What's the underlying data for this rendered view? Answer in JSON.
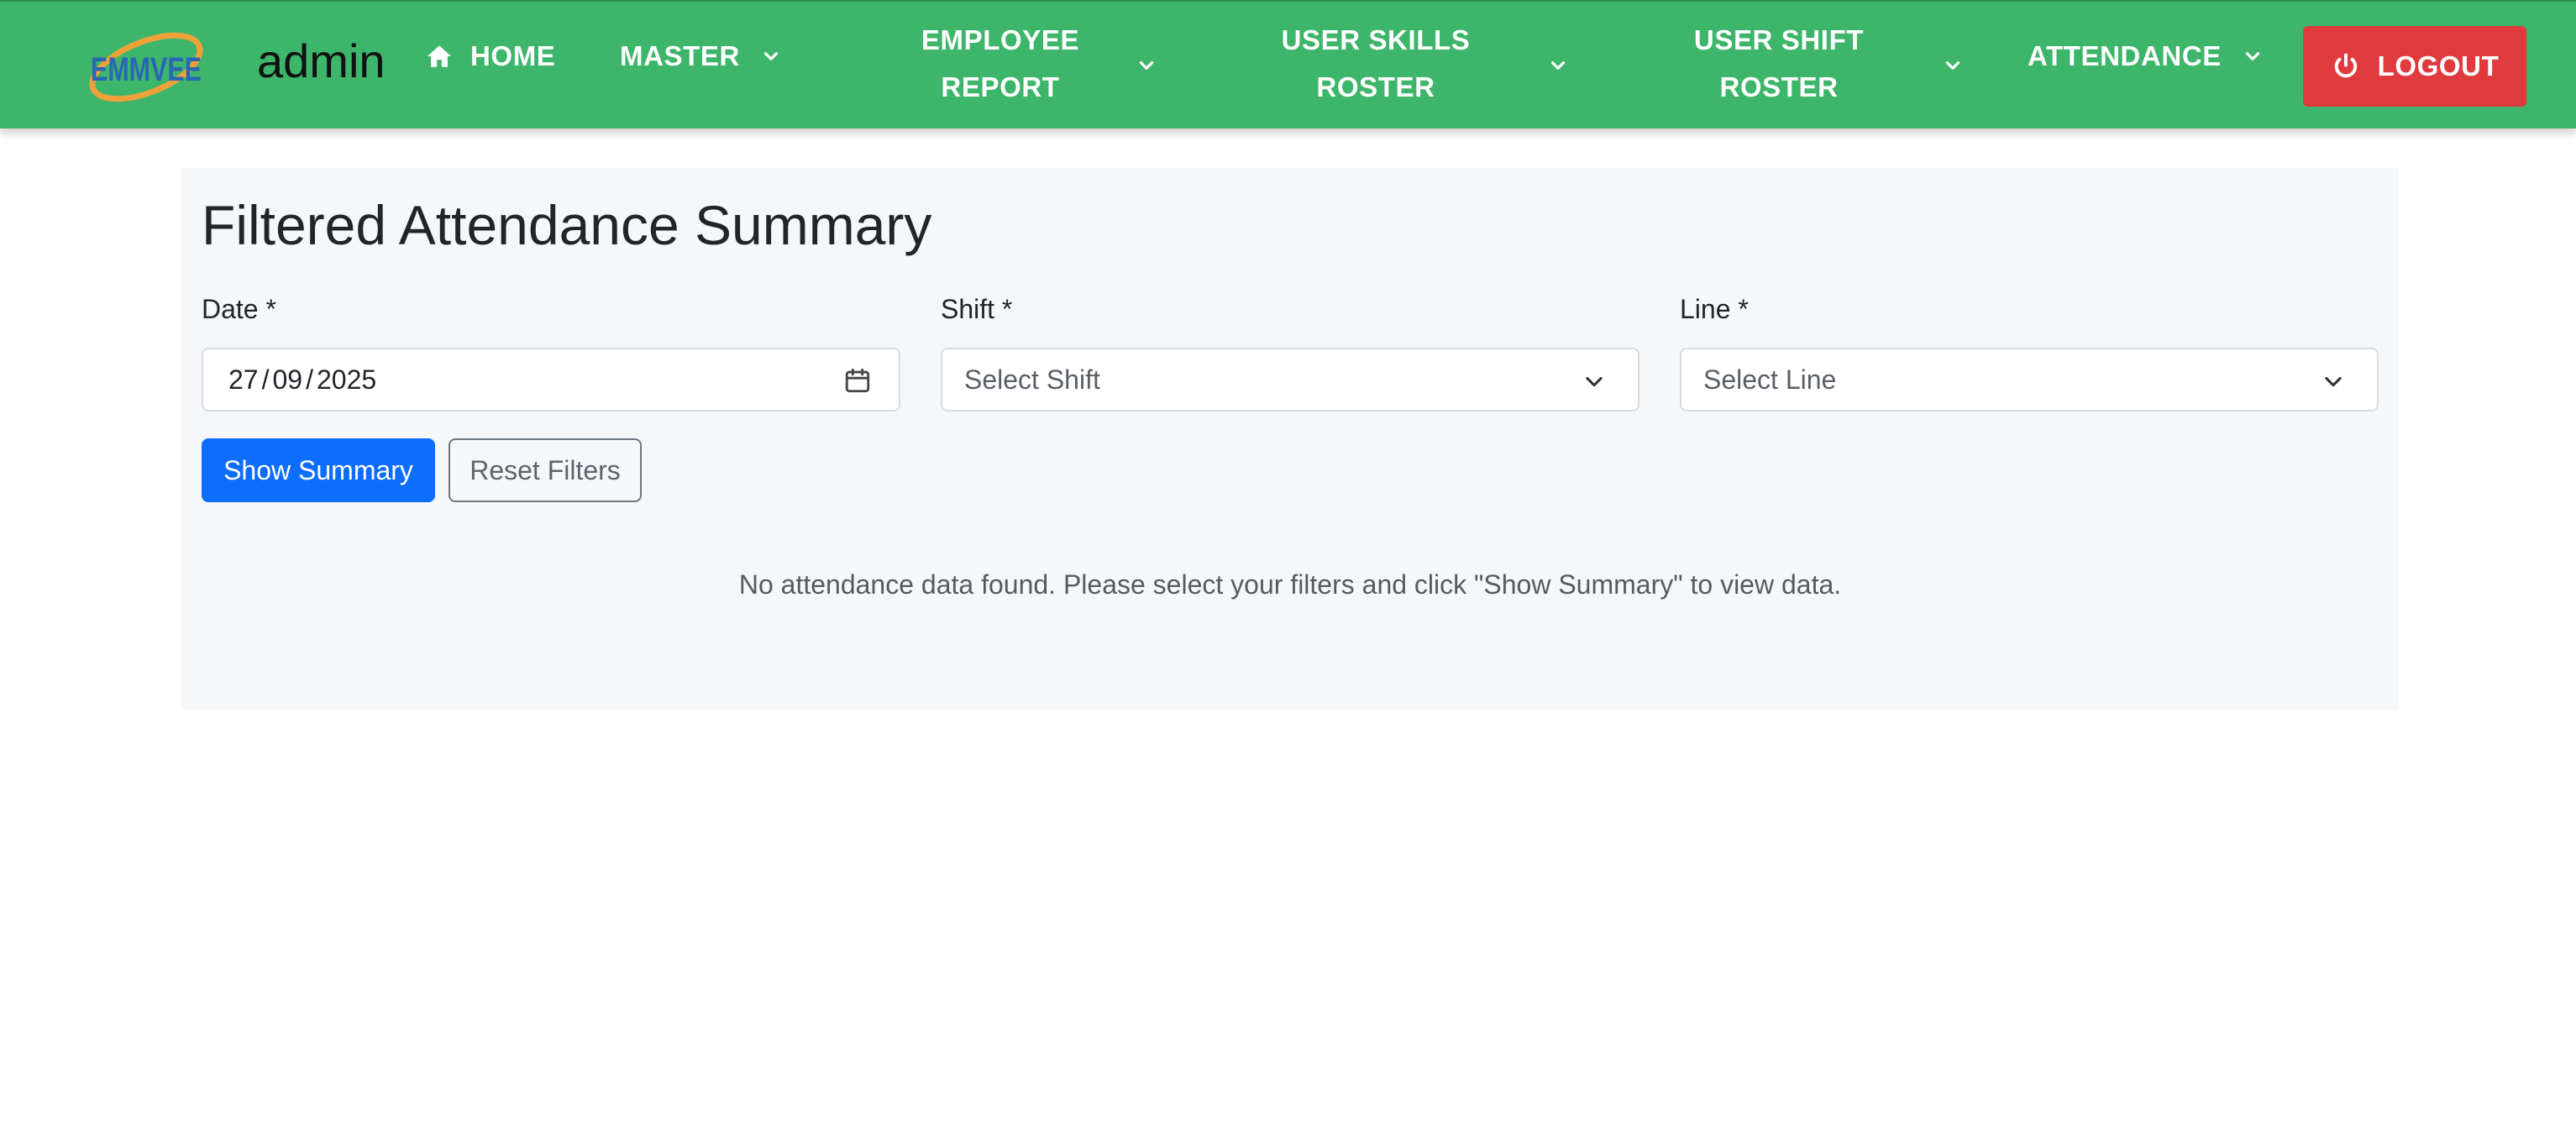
{
  "navbar": {
    "logo_text": "EMMVEE",
    "username": "admin",
    "items": [
      {
        "label": "HOME",
        "icon": "home-icon"
      },
      {
        "label": "MASTER",
        "icon": "chevron-down-icon"
      },
      {
        "line1": "EMPLOYEE",
        "line2": "REPORT",
        "icon": "chevron-down-icon"
      },
      {
        "line1": "USER SKILLS",
        "line2": "ROSTER",
        "icon": "chevron-down-icon"
      },
      {
        "line1": "USER SHIFT",
        "line2": "ROSTER",
        "icon": "chevron-down-icon"
      },
      {
        "label": "ATTENDANCE",
        "icon": "chevron-down-icon"
      }
    ],
    "logout_label": "LOGOUT",
    "colors": {
      "bar": "#3db56a",
      "logout": "#e03a3e"
    }
  },
  "page": {
    "title": "Filtered Attendance Summary",
    "filters": {
      "date": {
        "label": "Date *",
        "day": "27",
        "month": "09",
        "year": "2025",
        "sep": "/",
        "icon": "calendar-icon"
      },
      "shift": {
        "label": "Shift *",
        "placeholder": "Select Shift",
        "icon": "chevron-down-icon"
      },
      "line": {
        "label": "Line *",
        "placeholder": "Select Line",
        "icon": "chevron-down-icon"
      }
    },
    "buttons": {
      "show_summary": "Show Summary",
      "reset_filters": "Reset Filters"
    },
    "empty_message": "No attendance data found. Please select your filters and click \"Show Summary\" to view data.",
    "colors": {
      "primary": "#0d6efd",
      "card": "#f6f7f9"
    }
  }
}
